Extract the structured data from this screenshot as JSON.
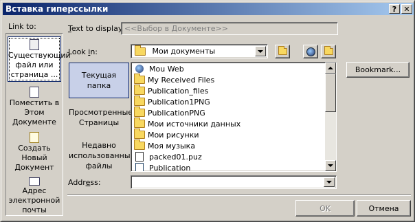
{
  "window": {
    "title": "Вставка гиперссылки",
    "help": "?",
    "close": "✕"
  },
  "link_to": {
    "label": "Link to:",
    "items": [
      {
        "label": "Существующий файл или страница ...",
        "icon": "existing-file-icon"
      },
      {
        "label": "Поместить в Этом Документе",
        "icon": "place-in-document-icon"
      },
      {
        "label": "Создать Новый Документ",
        "icon": "new-document-icon"
      },
      {
        "label": "Адрес электронной почты",
        "icon": "email-address-icon"
      }
    ]
  },
  "text_to_display": {
    "label": "Text to display:",
    "value": "<<Выбор в Документе>>"
  },
  "look_in": {
    "label": "Look in:",
    "value": "Мои документы"
  },
  "nav": {
    "current_folder": "Текущая папка",
    "browsed_pages": "Просмотренные Страницы",
    "recent_files": "Недавно использованные файлы"
  },
  "files": [
    {
      "name": "Mou Web",
      "icon": "web-folder-icon"
    },
    {
      "name": "My Received Files",
      "icon": "folder-icon"
    },
    {
      "name": "Publication_files",
      "icon": "folder-icon"
    },
    {
      "name": "Publication1PNG",
      "icon": "folder-icon"
    },
    {
      "name": "PublicationPNG",
      "icon": "folder-icon"
    },
    {
      "name": "Мои источники данных",
      "icon": "data-sources-folder-icon"
    },
    {
      "name": "Мои рисунки",
      "icon": "pictures-folder-icon"
    },
    {
      "name": "Моя музыка",
      "icon": "music-folder-icon"
    },
    {
      "name": "packed01.puz",
      "icon": "puz-file-icon"
    },
    {
      "name": "Publication",
      "icon": "publisher-file-icon"
    }
  ],
  "bookmark_button": "Bookmark...",
  "address": {
    "label": "Address:",
    "value": ""
  },
  "ok_button": "OK",
  "cancel_button": "Отмена"
}
